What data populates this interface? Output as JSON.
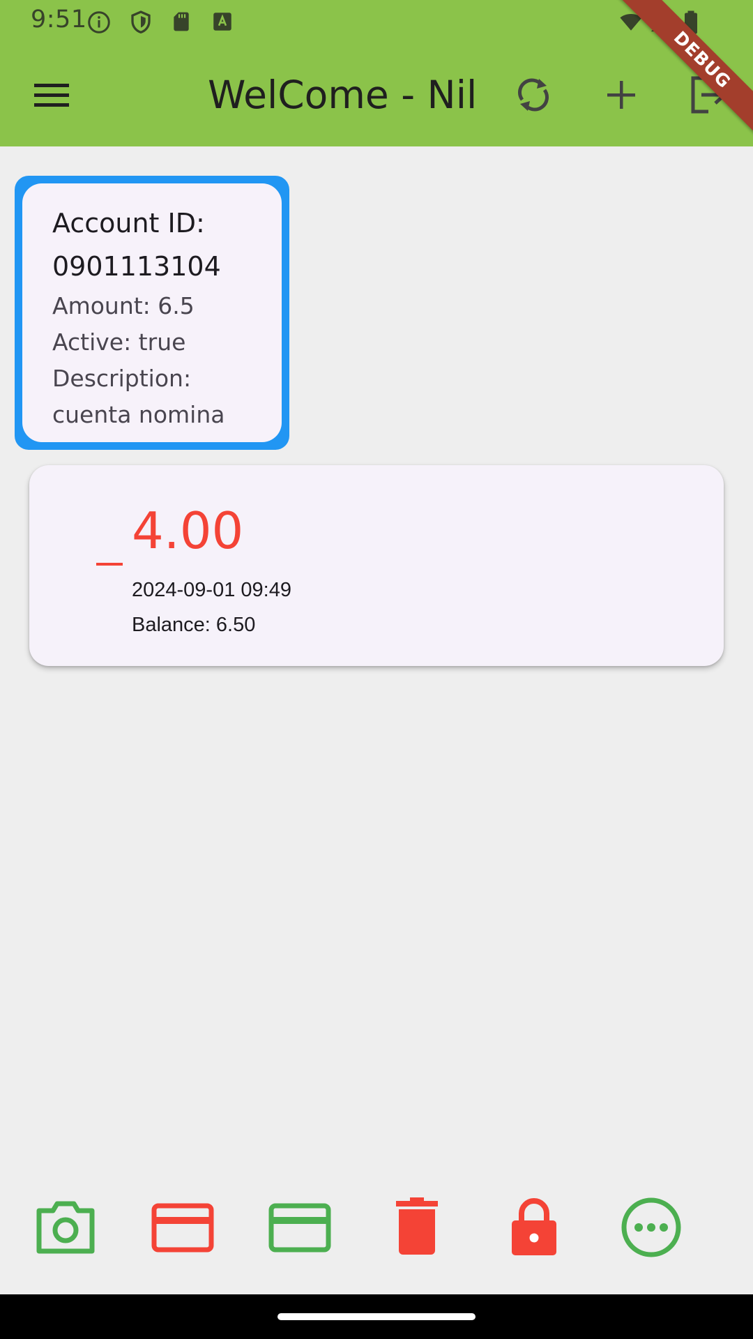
{
  "status_bar": {
    "time": "9:51",
    "icons": [
      "info-icon",
      "shield-icon",
      "sd-card-icon",
      "keyboard-a-icon",
      "wifi-icon",
      "cell-signal-icon",
      "battery-icon"
    ]
  },
  "app_bar": {
    "title": "WelCome - Nil",
    "icons": [
      "menu-icon",
      "refresh-icon",
      "add-icon",
      "logout-icon"
    ],
    "color": "#8bc34a"
  },
  "debug_banner": "DEBUG",
  "account": {
    "id_line1": "Account ID:",
    "id_line2": "0901113104",
    "amount": "Amount: 6.5",
    "active": "Active: true",
    "description_label": "Description:",
    "description_value": "cuenta nomina",
    "highlight_color": "#2196f3"
  },
  "transactions": [
    {
      "sign": "–",
      "amount": "4.00",
      "date": "2024-09-01 09:49",
      "balance": "Balance: 6.50",
      "color": "#f44336"
    }
  ],
  "bottom_actions": [
    {
      "icon": "camera-icon",
      "color": "#4caf50"
    },
    {
      "icon": "credit-card-icon",
      "color": "#f44336"
    },
    {
      "icon": "credit-card-icon",
      "color": "#4caf50"
    },
    {
      "icon": "delete-icon",
      "color": "#f44336"
    },
    {
      "icon": "lock-icon",
      "color": "#f44336"
    },
    {
      "icon": "more-icon",
      "color": "#4caf50"
    }
  ]
}
